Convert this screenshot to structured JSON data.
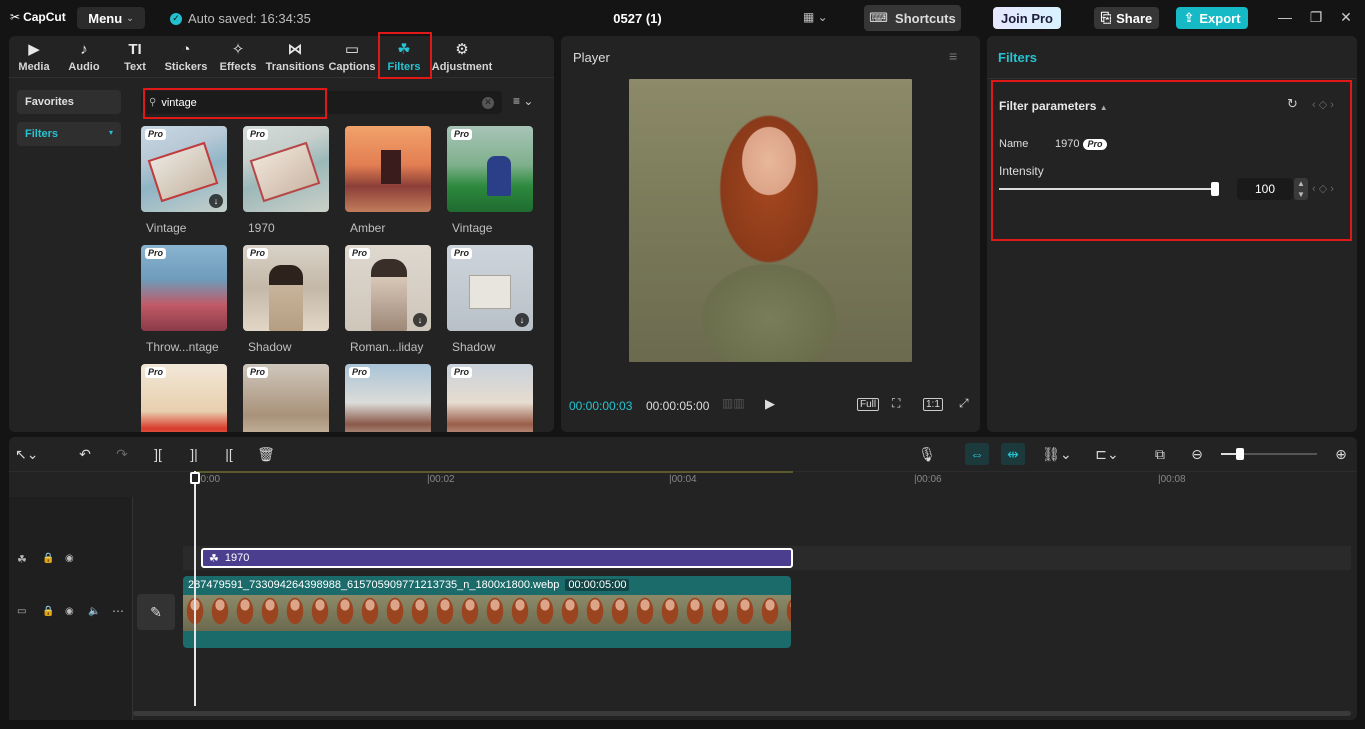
{
  "app": {
    "logo": "CapCut",
    "menu_label": "Menu",
    "autosave": "Auto saved: 16:34:35",
    "project_title": "0527 (1)",
    "shortcuts_label": "Shortcuts",
    "join_pro_label": "Join Pro",
    "share_label": "Share",
    "export_label": "Export"
  },
  "tabs": [
    {
      "label": "Media",
      "icon": "media-icon"
    },
    {
      "label": "Audio",
      "icon": "audio-icon"
    },
    {
      "label": "Text",
      "icon": "text-icon"
    },
    {
      "label": "Stickers",
      "icon": "stickers-icon"
    },
    {
      "label": "Effects",
      "icon": "effects-icon"
    },
    {
      "label": "Transitions",
      "icon": "transitions-icon"
    },
    {
      "label": "Captions",
      "icon": "captions-icon"
    },
    {
      "label": "Filters",
      "icon": "filters-icon",
      "active": true
    },
    {
      "label": "Adjustment",
      "icon": "adjustment-icon"
    }
  ],
  "sidebar": {
    "favorites": "Favorites",
    "filters": "Filters"
  },
  "search": {
    "value": "vintage"
  },
  "filters_grid": [
    {
      "label": "Vintage",
      "pro": "Pro",
      "download": true
    },
    {
      "label": "1970",
      "pro": "Pro",
      "download": false
    },
    {
      "label": "Amber",
      "pro": "",
      "download": false
    },
    {
      "label": "Vintage",
      "pro": "Pro",
      "download": false
    },
    {
      "label": "Throw...ntage",
      "pro": "Pro",
      "download": false
    },
    {
      "label": "Shadow",
      "pro": "Pro",
      "download": false
    },
    {
      "label": "Roman...liday",
      "pro": "Pro",
      "download": true
    },
    {
      "label": "Shadow",
      "pro": "Pro",
      "download": true
    },
    {
      "label": "",
      "pro": "Pro",
      "download": false
    },
    {
      "label": "",
      "pro": "Pro",
      "download": false
    },
    {
      "label": "",
      "pro": "Pro",
      "download": false
    },
    {
      "label": "",
      "pro": "Pro",
      "download": false
    }
  ],
  "player": {
    "title": "Player",
    "current_time": "00:00:00:03",
    "total_time": "00:00:05:00",
    "full_label": "Full",
    "ratio_label": "1:1"
  },
  "filters_panel": {
    "title": "Filters",
    "params_title": "Filter parameters",
    "name_label": "Name",
    "name_value": "1970",
    "pro_badge": "Pro",
    "intensity_label": "Intensity",
    "intensity_value": "100",
    "intensity_fraction": 1.0
  },
  "timeline": {
    "ruler": [
      "00:00",
      "|00:02",
      "|00:04",
      "|00:06",
      "|00:08"
    ],
    "filter_clip_label": "1970",
    "video_clip_name": "287479591_733094264398988_615705909771213735_n_1800x1800.webp",
    "video_clip_duration": "00:00:05:00"
  },
  "colors": {
    "accent": "#27c3d0",
    "export": "#16b9c6",
    "highlight": "#e01818",
    "filter_clip": "#4b3e8e",
    "video_clip": "#1b6b6b"
  }
}
